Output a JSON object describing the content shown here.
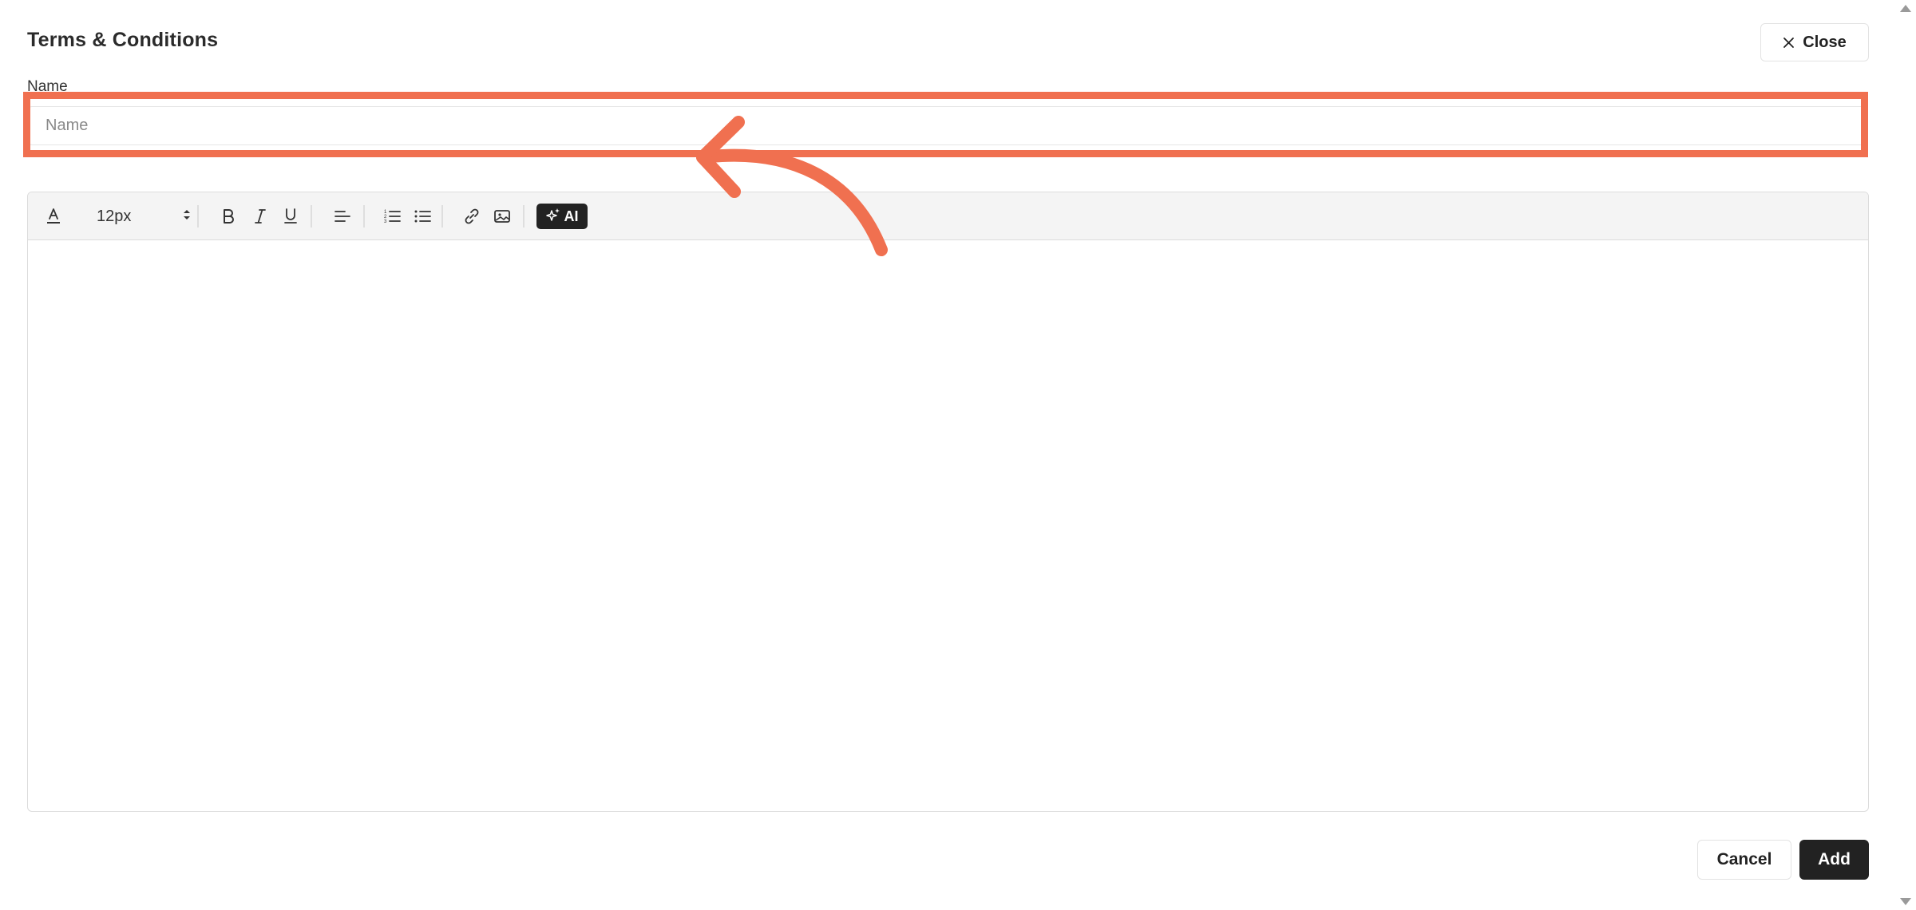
{
  "dialog": {
    "title": "Terms & Conditions",
    "close_label": "Close"
  },
  "name_field": {
    "label": "Name",
    "placeholder": "Name",
    "value": ""
  },
  "toolbar": {
    "font_size": "12px",
    "ai_label": "AI",
    "icons": [
      "text-color-icon",
      "bold-icon",
      "italic-icon",
      "underline-icon",
      "align-left-icon",
      "numbered-list-icon",
      "bullet-list-icon",
      "link-icon",
      "image-icon",
      "sparkle-icon"
    ]
  },
  "editor": {
    "content": ""
  },
  "footer": {
    "cancel_label": "Cancel",
    "add_label": "Add"
  },
  "colors": {
    "highlight": "#f07050",
    "primary_button": "#222222"
  }
}
